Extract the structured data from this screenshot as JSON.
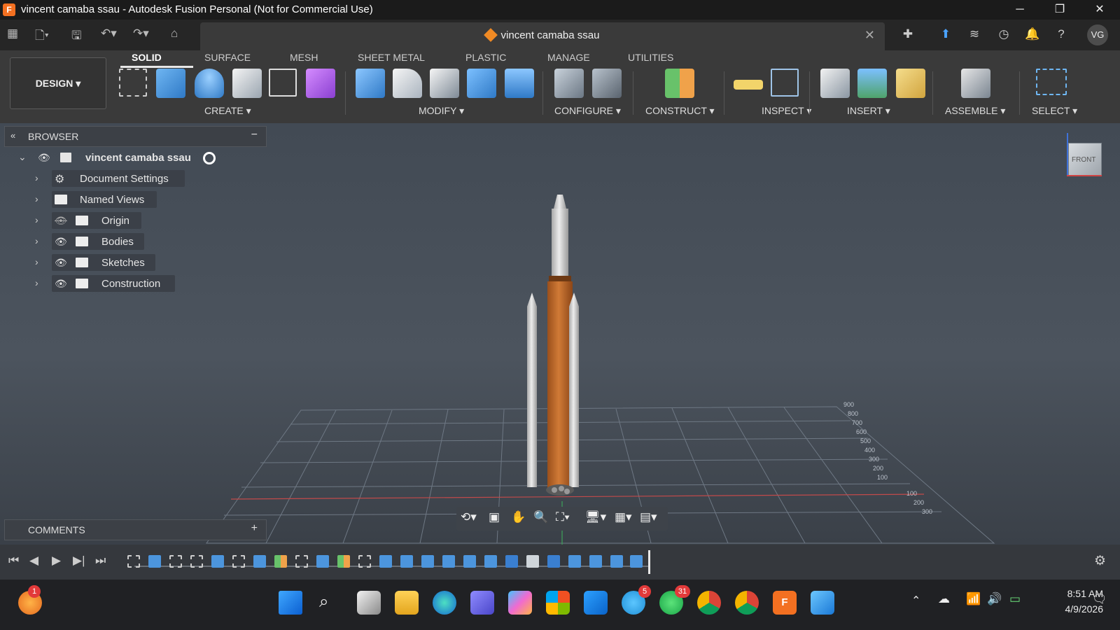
{
  "window": {
    "title": "vincent camaba ssau - Autodesk Fusion Personal (Not for Commercial Use)",
    "app_icon": "F",
    "controls": [
      "─",
      "❐",
      "✕"
    ]
  },
  "document_tab": {
    "title": "vincent camaba ssau"
  },
  "user": {
    "initials": "VG"
  },
  "workspace": {
    "label": "DESIGN"
  },
  "ribbon_tabs": [
    "SOLID",
    "SURFACE",
    "MESH",
    "SHEET METAL",
    "PLASTIC",
    "MANAGE",
    "UTILITIES"
  ],
  "ribbon_groups": [
    "CREATE",
    "MODIFY",
    "CONFIGURE",
    "CONSTRUCT",
    "INSPECT",
    "INSERT",
    "ASSEMBLE",
    "SELECT"
  ],
  "browser": {
    "title": "BROWSER",
    "root": "vincent camaba ssau",
    "items": [
      "Document Settings",
      "Named Views",
      "Origin",
      "Bodies",
      "Sketches",
      "Construction"
    ]
  },
  "comments": {
    "title": "COMMENTS"
  },
  "viewcube": {
    "face": "FRONT"
  },
  "grid_labels": [
    "900",
    "800",
    "700",
    "600",
    "500",
    "400",
    "300",
    "200",
    "100",
    "100",
    "200",
    "300"
  ],
  "taskbar": {
    "time": "8:51 AM",
    "date": "4/9/2026",
    "badges": {
      "system": "1",
      "telegram": "5",
      "whatsapp": "31"
    }
  },
  "colors": {
    "accent": "#f37021",
    "body": "#c26a2a",
    "booster": "#d8d8d8"
  }
}
